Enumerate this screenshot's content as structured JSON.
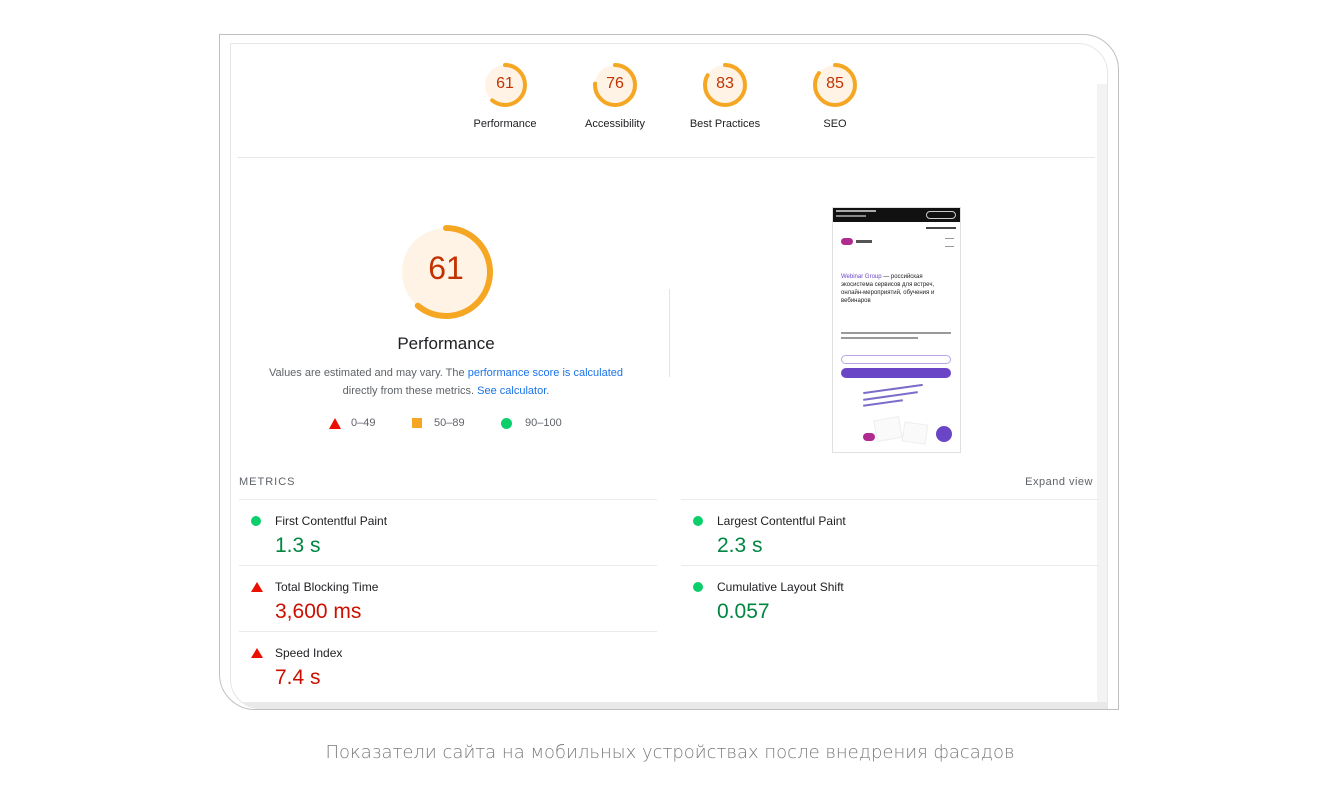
{
  "categories": [
    {
      "label": "Performance",
      "score": 61,
      "color": "#f5a623"
    },
    {
      "label": "Accessibility",
      "score": 76,
      "color": "#f5a623"
    },
    {
      "label": "Best Practices",
      "score": 83,
      "color": "#f5a623"
    },
    {
      "label": "SEO",
      "score": 85,
      "color": "#f5a623"
    }
  ],
  "performance": {
    "score": 61,
    "title": "Performance",
    "desc_prefix": "Values are estimated and may vary. The ",
    "desc_link1": "performance score is calculated",
    "desc_mid": "directly from these metrics. ",
    "desc_link2": "See calculator."
  },
  "legend": {
    "fail": "0–49",
    "average": "50–89",
    "pass": "90–100"
  },
  "metrics": {
    "header": "METRICS",
    "expand": "Expand view",
    "fcp": {
      "name": "First Contentful Paint",
      "value": "1.3 s"
    },
    "lcp": {
      "name": "Largest Contentful Paint",
      "value": "2.3 s"
    },
    "tbt": {
      "name": "Total Blocking Time",
      "value": "3,600 ms"
    },
    "cls": {
      "name": "Cumulative Layout Shift",
      "value": "0.057"
    },
    "si": {
      "name": "Speed Index",
      "value": "7.4 s"
    }
  },
  "screenshot": {
    "brand": "Webinar Group",
    "headline": " — российская экосистема сервисов для встреч, онлайн-мероприятий, обучения и вебинаров"
  },
  "colors": {
    "average": "#f5a623",
    "fail": "#eb0f00",
    "pass": "#0cce6b",
    "score_text": "#c33300"
  },
  "caption": "Показатели сайта на мобильных устройствах после внедрения фасадов"
}
